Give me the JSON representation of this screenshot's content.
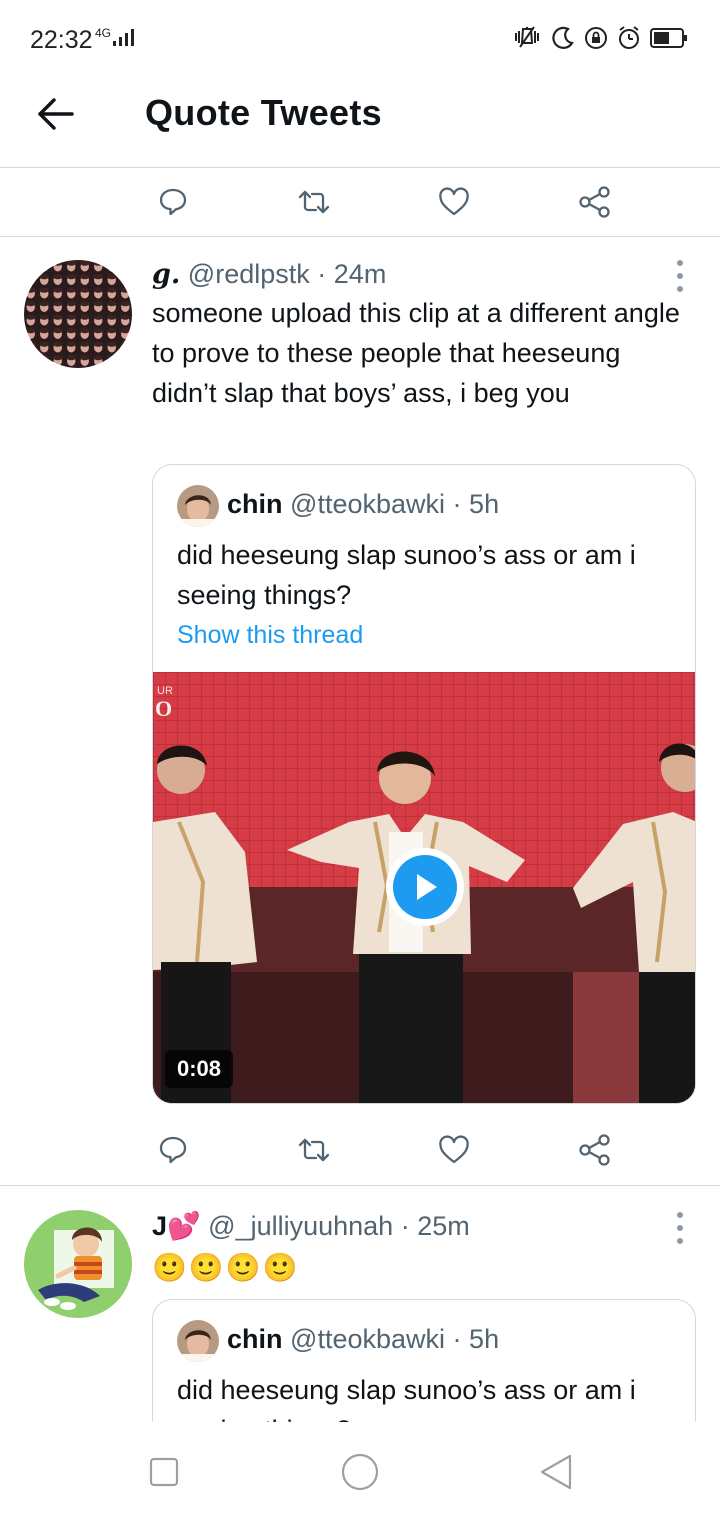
{
  "status_bar": {
    "time": "22:32",
    "network": "4G"
  },
  "header": {
    "back_icon": "arrow-left-icon",
    "title": "Quote Tweets"
  },
  "top_actions": [
    "reply-icon",
    "retweet-icon",
    "like-icon",
    "share-icon"
  ],
  "tweets": [
    {
      "display_name": "g.",
      "handle": "@redlpstk",
      "time": "24m",
      "text": "someone upload this clip at a different angle to prove to these people that heeseung didn’t slap that boys’ ass, i beg you",
      "quote": {
        "display_name": "chin",
        "handle": "@tteokbawki",
        "time": "5h",
        "text": "did heeseung slap sunoo’s ass or am i seeing things?",
        "link": "Show this thread",
        "media": {
          "type": "video",
          "duration": "0:08",
          "overlay_text": "UR\nO"
        }
      },
      "actions": [
        "reply-icon",
        "retweet-icon",
        "like-icon",
        "share-icon"
      ]
    },
    {
      "display_name": "J💕",
      "handle": "@_julliyuuhnah",
      "time": "25m",
      "text": "🙂🙂🙂🙂",
      "quote": {
        "display_name": "chin",
        "handle": "@tteokbawki",
        "time": "5h",
        "text": "did heeseung slap sunoo’s ass or am i seeing things?"
      }
    }
  ],
  "colors": {
    "link": "#1d9bf0",
    "secondary_text": "#536471",
    "divider": "#cfd9de"
  }
}
